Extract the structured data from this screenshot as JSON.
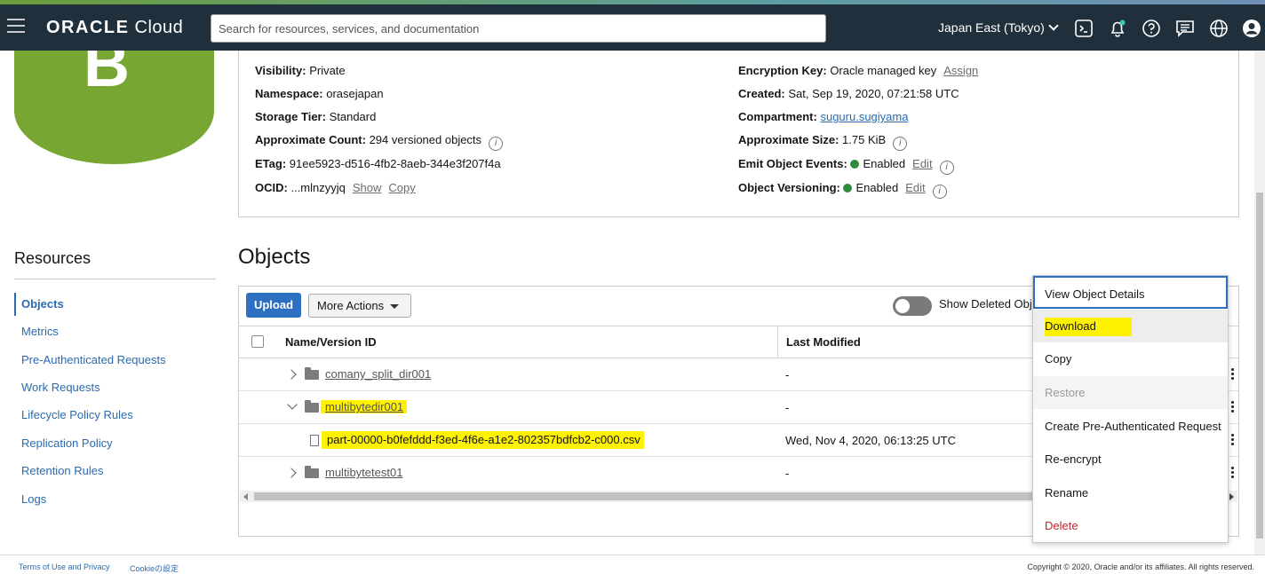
{
  "header": {
    "logo_bold": "ORACLE",
    "logo_light": "Cloud",
    "search_placeholder": "Search for resources, services, and documentation",
    "region": "Japan East (Tokyo)"
  },
  "details": {
    "left": [
      {
        "label": "Visibility:",
        "value": "Private"
      },
      {
        "label": "Namespace:",
        "value": "orasejapan"
      },
      {
        "label": "Storage Tier:",
        "value": "Standard"
      },
      {
        "label": "Approximate Count:",
        "value": "294 versioned objects"
      },
      {
        "label": "ETag:",
        "value": "91ee5923-d516-4fb2-8aeb-344e3f207f4a"
      },
      {
        "label": "OCID:",
        "value": "...mlnzyyjq",
        "link1": "Show",
        "link2": "Copy"
      }
    ],
    "right": [
      {
        "label": "Encryption Key:",
        "value": "Oracle managed key",
        "link": "Assign"
      },
      {
        "label": "Created:",
        "value": "Sat, Sep 19, 2020, 07:21:58 UTC"
      },
      {
        "label": "Compartment:",
        "value": "suguru.sugiyama"
      },
      {
        "label": "Approximate Size:",
        "value": "1.75 KiB"
      },
      {
        "label": "Emit Object Events:",
        "value": "Enabled",
        "link": "Edit"
      },
      {
        "label": "Object Versioning:",
        "value": "Enabled",
        "link": "Edit"
      }
    ],
    "bucket_letter": "B"
  },
  "resources": {
    "title": "Resources",
    "items": [
      {
        "label": "Objects",
        "active": true
      },
      {
        "label": "Metrics"
      },
      {
        "label": "Pre-Authenticated Requests"
      },
      {
        "label": "Work Requests"
      },
      {
        "label": "Lifecycle Policy Rules"
      },
      {
        "label": "Replication Policy"
      },
      {
        "label": "Retention Rules"
      },
      {
        "label": "Logs"
      }
    ]
  },
  "objects": {
    "title": "Objects",
    "upload_label": "Upload",
    "more_actions_label": "More Actions",
    "show_deleted_label": "Show Deleted Objects",
    "columns": [
      "Name/Version ID",
      "Last Modified"
    ],
    "rows": [
      {
        "name": "comany_split_dir001",
        "type": "folder",
        "expanded": false,
        "last_modified": "-"
      },
      {
        "name": "multibytedir001",
        "type": "folder",
        "expanded": true,
        "last_modified": "-"
      },
      {
        "name": "part-00000-b0fefddd-f3ed-4f6e-a1e2-802357bdfcb2-c000.csv",
        "type": "file",
        "last_modified": "Wed, Nov 4, 2020, 06:13:25 UTC"
      },
      {
        "name": "multibytetest01",
        "type": "folder",
        "expanded": false,
        "last_modified": "-"
      }
    ]
  },
  "context_menu": {
    "items": [
      {
        "label": "View Object Details"
      },
      {
        "label": "Download"
      },
      {
        "label": "Copy"
      },
      {
        "label": "Restore",
        "disabled": true
      },
      {
        "label": "Create Pre-Authenticated Request"
      },
      {
        "label": "Re-encrypt"
      },
      {
        "label": "Rename"
      },
      {
        "label": "Delete",
        "danger": true
      }
    ]
  },
  "footer": {
    "terms": "Terms of Use and Privacy",
    "cookie": "Cookieの設定",
    "copyright": "Copyright © 2020, Oracle and/or its affiliates. All rights reserved."
  },
  "colors": {
    "header_bg": "#1f2f3b",
    "bucket_green": "#78a632",
    "primary_blue": "#2d6fc1",
    "highlight_yellow": "#fff200",
    "enabled_green": "#2f8a3e",
    "danger_red": "#c4262e"
  }
}
